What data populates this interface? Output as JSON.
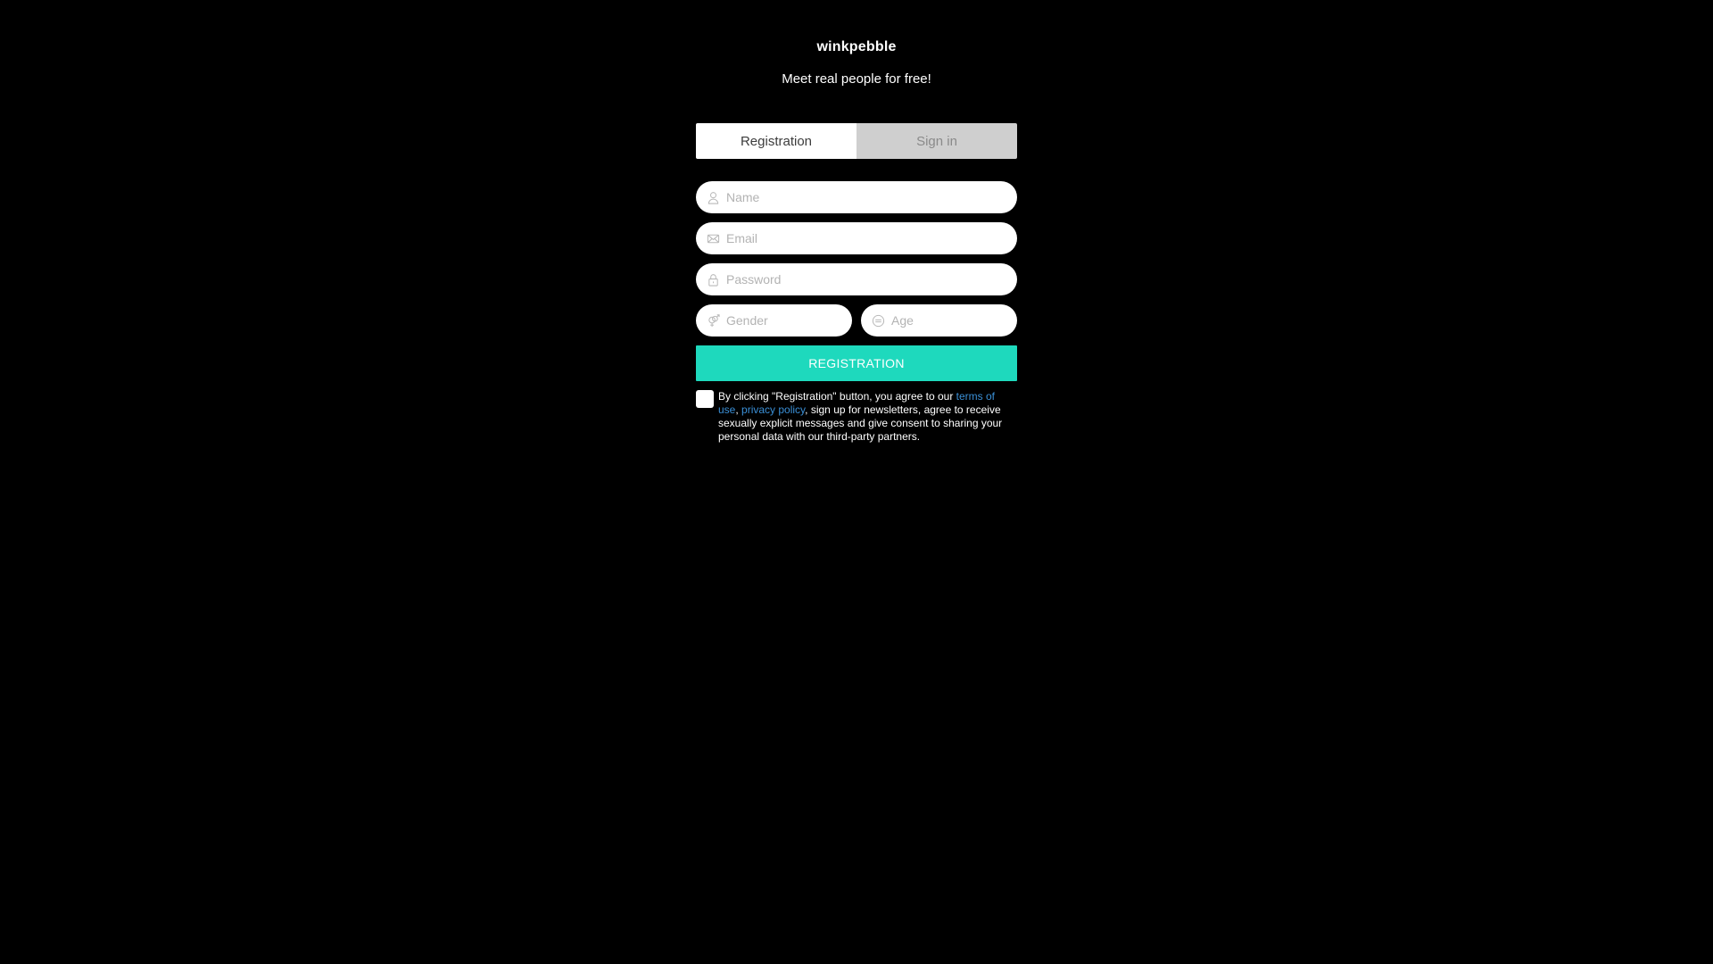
{
  "brand": {
    "name": "winkpebble",
    "tagline": "Meet real people for free!"
  },
  "tabs": [
    {
      "label": "Registration",
      "active": true
    },
    {
      "label": "Sign in",
      "active": false
    }
  ],
  "form": {
    "name": {
      "placeholder": "Name",
      "value": "",
      "icon": "user-icon"
    },
    "email": {
      "placeholder": "Email",
      "value": "",
      "icon": "envelope-icon"
    },
    "password": {
      "placeholder": "Password",
      "value": "",
      "icon": "lock-icon"
    },
    "gender": {
      "placeholder": "Gender",
      "value": "",
      "icon": "gender-icon"
    },
    "age": {
      "placeholder": "Age",
      "value": "",
      "icon": "age-icon"
    },
    "submit_label": "REGISTRATION"
  },
  "consent": {
    "checked": false,
    "text_before": "By clicking \"Registration\" button, you agree to our ",
    "terms_link": "terms of use",
    "separator": ", ",
    "privacy_link": "privacy policy",
    "text_after": ", sign up for newsletters, agree to receive sexually explicit messages and give consent to sharing your personal data with our third-party partners."
  },
  "colors": {
    "background": "#000000",
    "accent": "#1ed9bd",
    "link": "#3a8fd6",
    "inactive_tab": "#cfcfcf"
  }
}
